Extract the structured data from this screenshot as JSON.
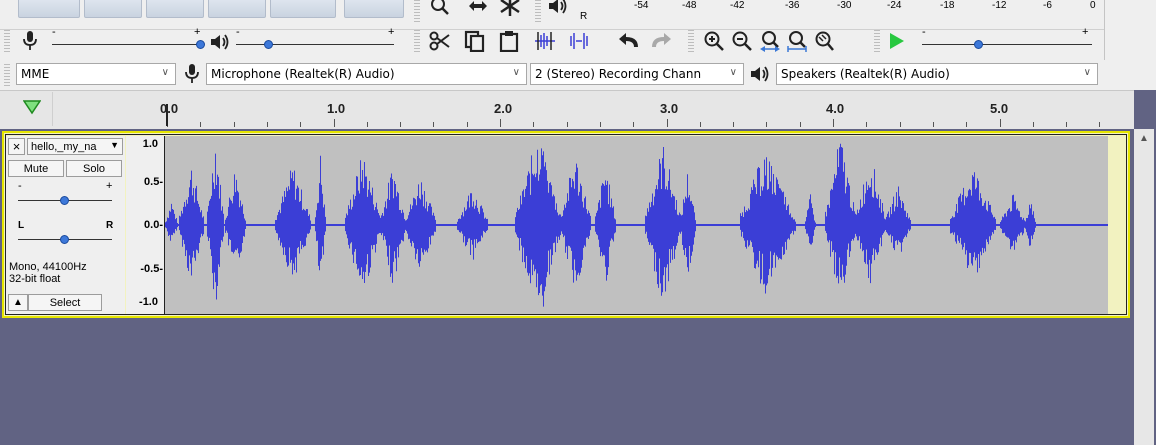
{
  "meter": {
    "ticks": [
      "-54",
      "-48",
      "-42",
      "-36",
      "-30",
      "-24",
      "-18",
      "-12",
      "-6",
      "0"
    ],
    "channel_r": "R"
  },
  "mixer": {
    "minus": "-",
    "plus": "+"
  },
  "device": {
    "host": "MME",
    "recording": "Microphone (Realtek(R) Audio)",
    "channels": "2 (Stereo) Recording Chann",
    "playback": "Speakers (Realtek(R) Audio)"
  },
  "ruler": {
    "labels": [
      "0.0",
      "1.0",
      "2.0",
      "3.0",
      "4.0",
      "5.0"
    ]
  },
  "track": {
    "close": "×",
    "name": "hello,_my_na",
    "mute": "Mute",
    "solo": "Solo",
    "gain_minus": "-",
    "gain_plus": "+",
    "pan_left": "L",
    "pan_right": "R",
    "info_line1": "Mono, 44100Hz",
    "info_line2": "32-bit float",
    "collapse": "▲",
    "select": "Select",
    "scale": [
      "1.0",
      "0.5-",
      "0.0-",
      "-0.5-",
      "-1.0"
    ]
  },
  "colors": {
    "waveform": "#3b3ed6",
    "track_bg": "#c0c0c0",
    "selected_border": "#ffff80",
    "workspace": "#616383"
  },
  "icons": {
    "zoom": "magnifier",
    "fit": "double-arrow",
    "multi": "asterisk",
    "speaker": "speaker",
    "mic": "microphone",
    "cut": "scissors",
    "copy": "copy",
    "paste": "clipboard",
    "undo": "undo-arrow",
    "redo": "redo-arrow",
    "play": "play-triangle"
  }
}
